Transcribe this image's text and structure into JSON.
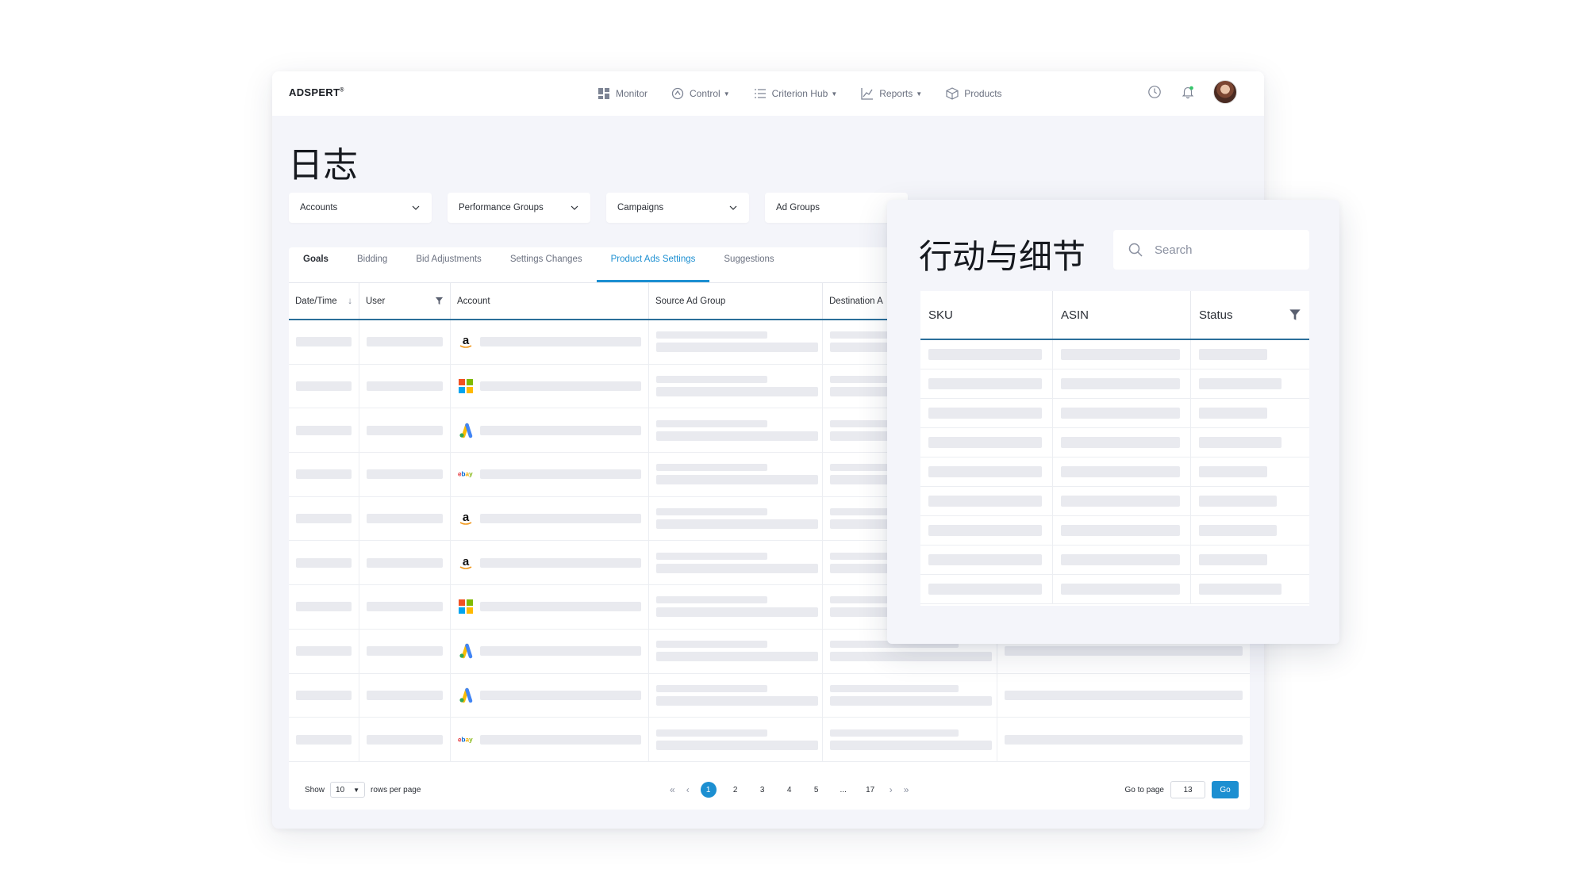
{
  "brand": {
    "name": "ADSPERT",
    "mark": "®"
  },
  "nav": [
    {
      "label": "Monitor",
      "icon": "dashboard-icon",
      "caret": false
    },
    {
      "label": "Control",
      "icon": "control-icon",
      "caret": true
    },
    {
      "label": "Criterion Hub",
      "icon": "list-icon",
      "caret": true
    },
    {
      "label": "Reports",
      "icon": "chart-icon",
      "caret": true
    },
    {
      "label": "Products",
      "icon": "box-icon",
      "caret": false
    }
  ],
  "page": {
    "title": "日志"
  },
  "filters": [
    "Accounts",
    "Performance Groups",
    "Campaigns",
    "Ad Groups"
  ],
  "tabs": [
    "Goals",
    "Bidding",
    "Bid Adjustments",
    "Settings Changes",
    "Product Ads Settings",
    "Suggestions"
  ],
  "active_tab": "Product Ads Settings",
  "table": {
    "columns": [
      "Date/Time",
      "User",
      "Account",
      "Source Ad Group",
      "Destination A"
    ],
    "row_accounts": [
      "amazon",
      "microsoft",
      "google-ads",
      "ebay",
      "amazon",
      "amazon",
      "microsoft",
      "google-ads",
      "google-ads",
      "ebay"
    ]
  },
  "pager": {
    "show": "Show",
    "rows_value": "10",
    "rows_per_page": "rows per page",
    "pages": [
      "1",
      "2",
      "3",
      "4",
      "5",
      "...",
      "17"
    ],
    "current_page": "1",
    "goto_label": "Go to page",
    "goto_value": "13",
    "go_button": "Go"
  },
  "detail_card": {
    "title": "行动与细节",
    "search_placeholder": "Search",
    "columns": [
      "SKU",
      "ASIN",
      "Status"
    ],
    "row_count": 9
  },
  "colors": {
    "accent": "#1c8fd1",
    "header_rule": "#2b6f9a",
    "placeholder": "#e9eaef"
  }
}
